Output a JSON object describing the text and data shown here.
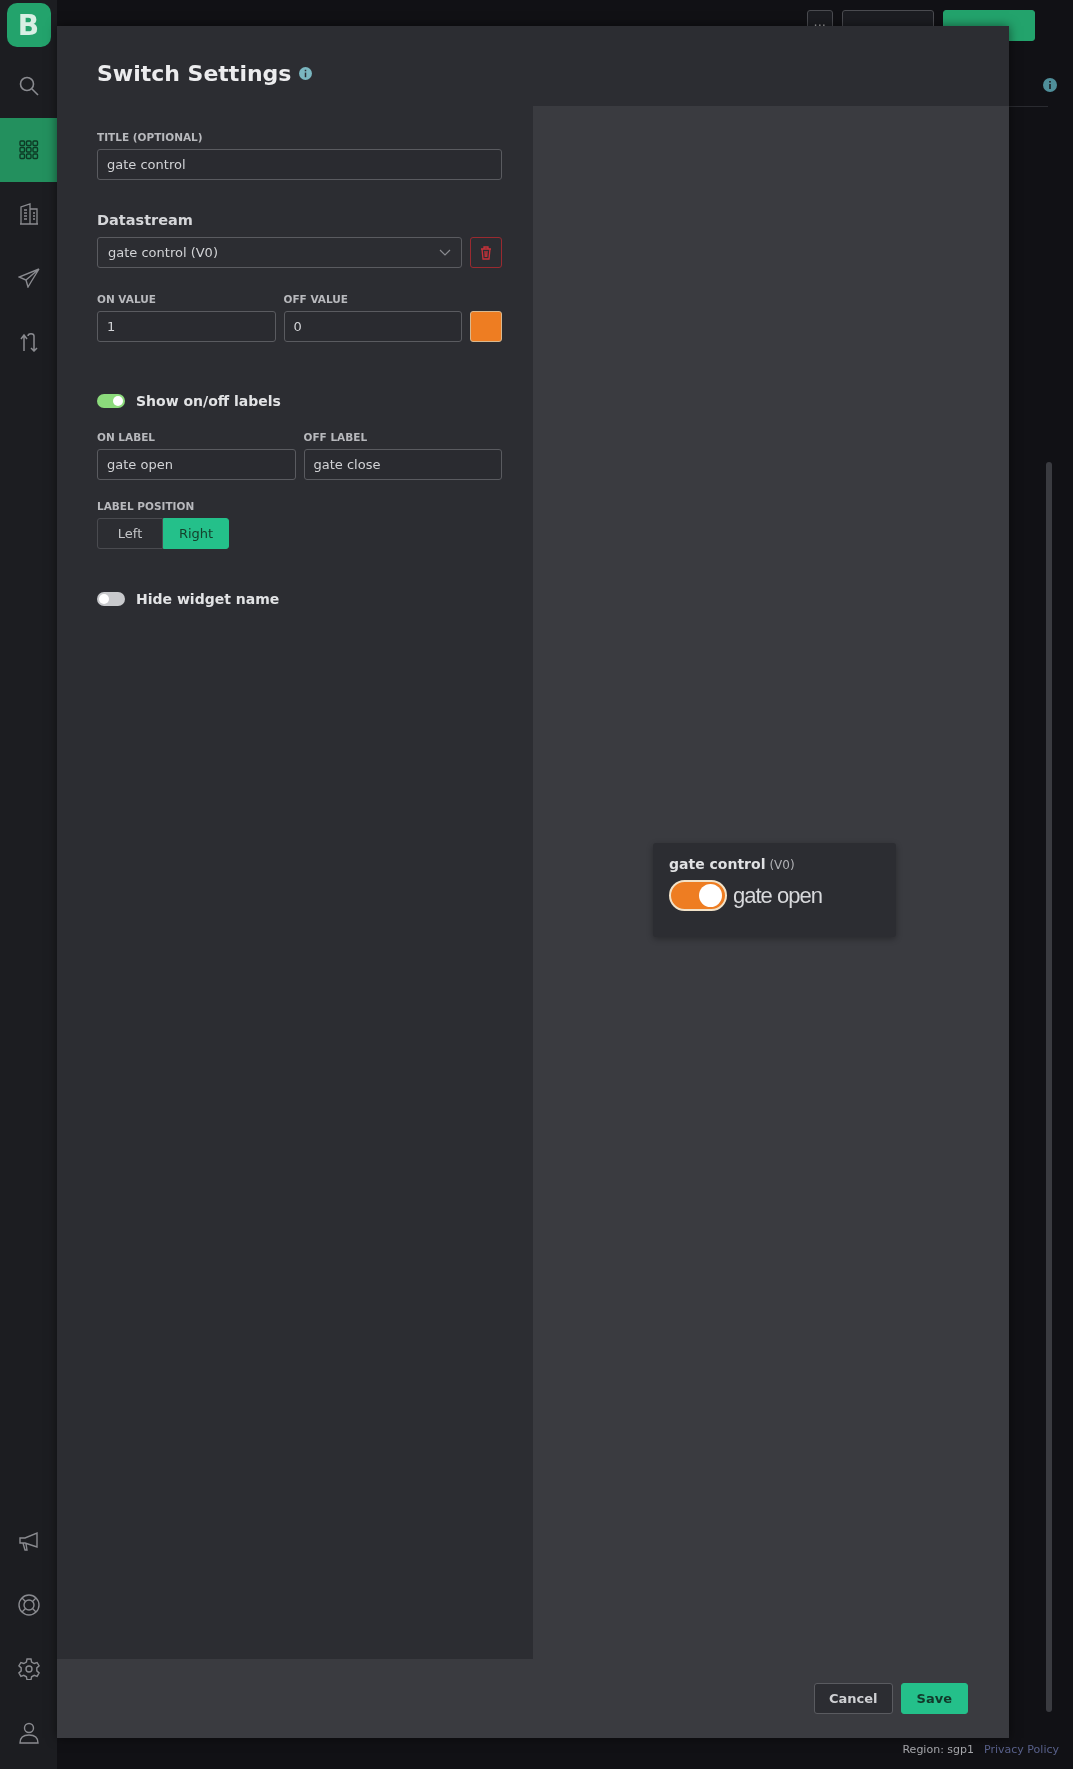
{
  "sidebar": {
    "logo": "B",
    "top_items": [
      {
        "selected": false
      },
      {
        "selected": true
      },
      {
        "selected": false
      },
      {
        "selected": false
      },
      {
        "selected": false
      }
    ],
    "bottom_items": [
      {
        "selected": false
      },
      {
        "selected": false
      },
      {
        "selected": false
      },
      {
        "selected": false
      }
    ]
  },
  "header": {
    "more_button": "···"
  },
  "modal": {
    "title": "Switch Settings",
    "title_field": {
      "label": "TITLE (OPTIONAL)",
      "value": "gate control"
    },
    "datastream": {
      "heading": "Datastream",
      "value": "gate control (V0)"
    },
    "on_value": {
      "label": "ON VALUE",
      "value": "1"
    },
    "off_value": {
      "label": "OFF VALUE",
      "value": "0"
    },
    "color": "#ee7d22",
    "show_labels": {
      "label": "Show on/off labels",
      "on": true
    },
    "on_label": {
      "label": "ON LABEL",
      "value": "gate open"
    },
    "off_label": {
      "label": "OFF LABEL",
      "value": "gate close"
    },
    "label_position": {
      "label": "LABEL POSITION",
      "options": [
        {
          "label": "Left",
          "selected": false
        },
        {
          "label": "Right",
          "selected": true
        }
      ]
    },
    "hide_name": {
      "label": "Hide widget name",
      "on": false
    },
    "preview": {
      "title": "gate control",
      "pin": "(V0)",
      "on": true,
      "state_label": "gate open"
    },
    "buttons": {
      "cancel": "Cancel",
      "save": "Save"
    }
  },
  "footer": {
    "region": "Region: sgp1",
    "privacy_link": "Privacy Policy"
  }
}
